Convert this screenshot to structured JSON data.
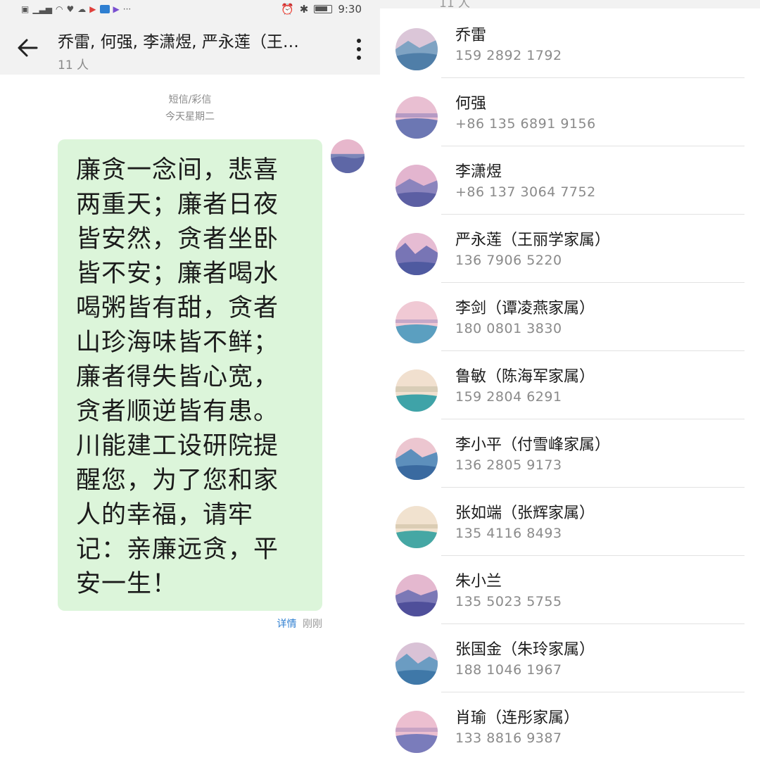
{
  "status_bar": {
    "time": "9:30"
  },
  "conversation": {
    "title": "乔雷, 何强, 李潇煜, 严永莲（王…",
    "member_count": "11 人",
    "channel": "短信/彩信",
    "date": "今天星期二",
    "message": {
      "lines": [
        "廉贪一念间，悲喜",
        "两重天；廉者日夜",
        "皆安然，贪者坐卧",
        "皆不安；廉者喝水",
        "喝粥皆有甜，贪者",
        "山珍海味皆不鲜；",
        "廉者得失皆心宽，",
        "贪者顺逆皆有患。",
        "川能建工设研院提",
        "醒您，为了您和家",
        "人的幸福，请牢",
        "记：亲廉远贪，平",
        "安一生！"
      ],
      "detail_label": "详情",
      "time": "刚刚"
    }
  },
  "recipients": {
    "header_partial": "11 人",
    "contacts": [
      {
        "name": "乔雷",
        "phone": "159 2892 1792"
      },
      {
        "name": "何强",
        "phone": "+86 135 6891 9156"
      },
      {
        "name": "李潇煜",
        "phone": "+86 137 3064 7752"
      },
      {
        "name": "严永莲（王丽学家属）",
        "phone": "136 7906 5220"
      },
      {
        "name": "李剑（谭凌燕家属）",
        "phone": "180 0801 3830"
      },
      {
        "name": "鲁敏（陈海军家属）",
        "phone": "159 2804 6291"
      },
      {
        "name": "李小平（付雪峰家属）",
        "phone": "136 2805 9173"
      },
      {
        "name": "张如端（张辉家属）",
        "phone": "135 4116 8493"
      },
      {
        "name": "朱小兰",
        "phone": "135 5023 5755"
      },
      {
        "name": "张国金（朱玲家属）",
        "phone": "188 1046 1967"
      },
      {
        "name": "肖瑜（连彤家属）",
        "phone": "133 8816 9387"
      }
    ]
  },
  "colors": {
    "bubble": "#dcf5da",
    "link": "#2f7fd1",
    "bar": "#f2f2f2"
  }
}
